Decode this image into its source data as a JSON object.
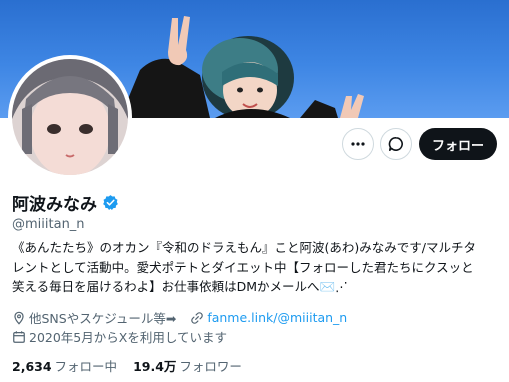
{
  "profile": {
    "display_name": "阿波みなみ",
    "handle": "@miiitan_n",
    "verified": true,
    "bio_lines": [
      "《あんたたち》のオカン『令和のドラえもん』こと阿波(あわ)みなみです/マルチタ",
      "レントとして活動中。愛犬ポテトとダイエット中【フォローした君たちにクスッと",
      "笑える毎日を届けるわよ】お仕事依頼はDMかメールへ✉️⋰"
    ],
    "other_sns_label": "他SNSやスケジュール等➡",
    "website": "fanme.link/@miiitan_n",
    "joined": "2020年5月からXを利用しています",
    "following_count": "2,634",
    "following_label": "フォロー中",
    "followers_count": "19.4万",
    "followers_label": "フォロワー"
  },
  "actions": {
    "more_icon": "more-icon",
    "message_icon": "message-icon",
    "follow_label": "フォロー"
  },
  "colors": {
    "banner": "#3e86e4",
    "link": "#1d9bf0",
    "verified": "#1d9bf0",
    "follow_button": "#0f1419"
  }
}
